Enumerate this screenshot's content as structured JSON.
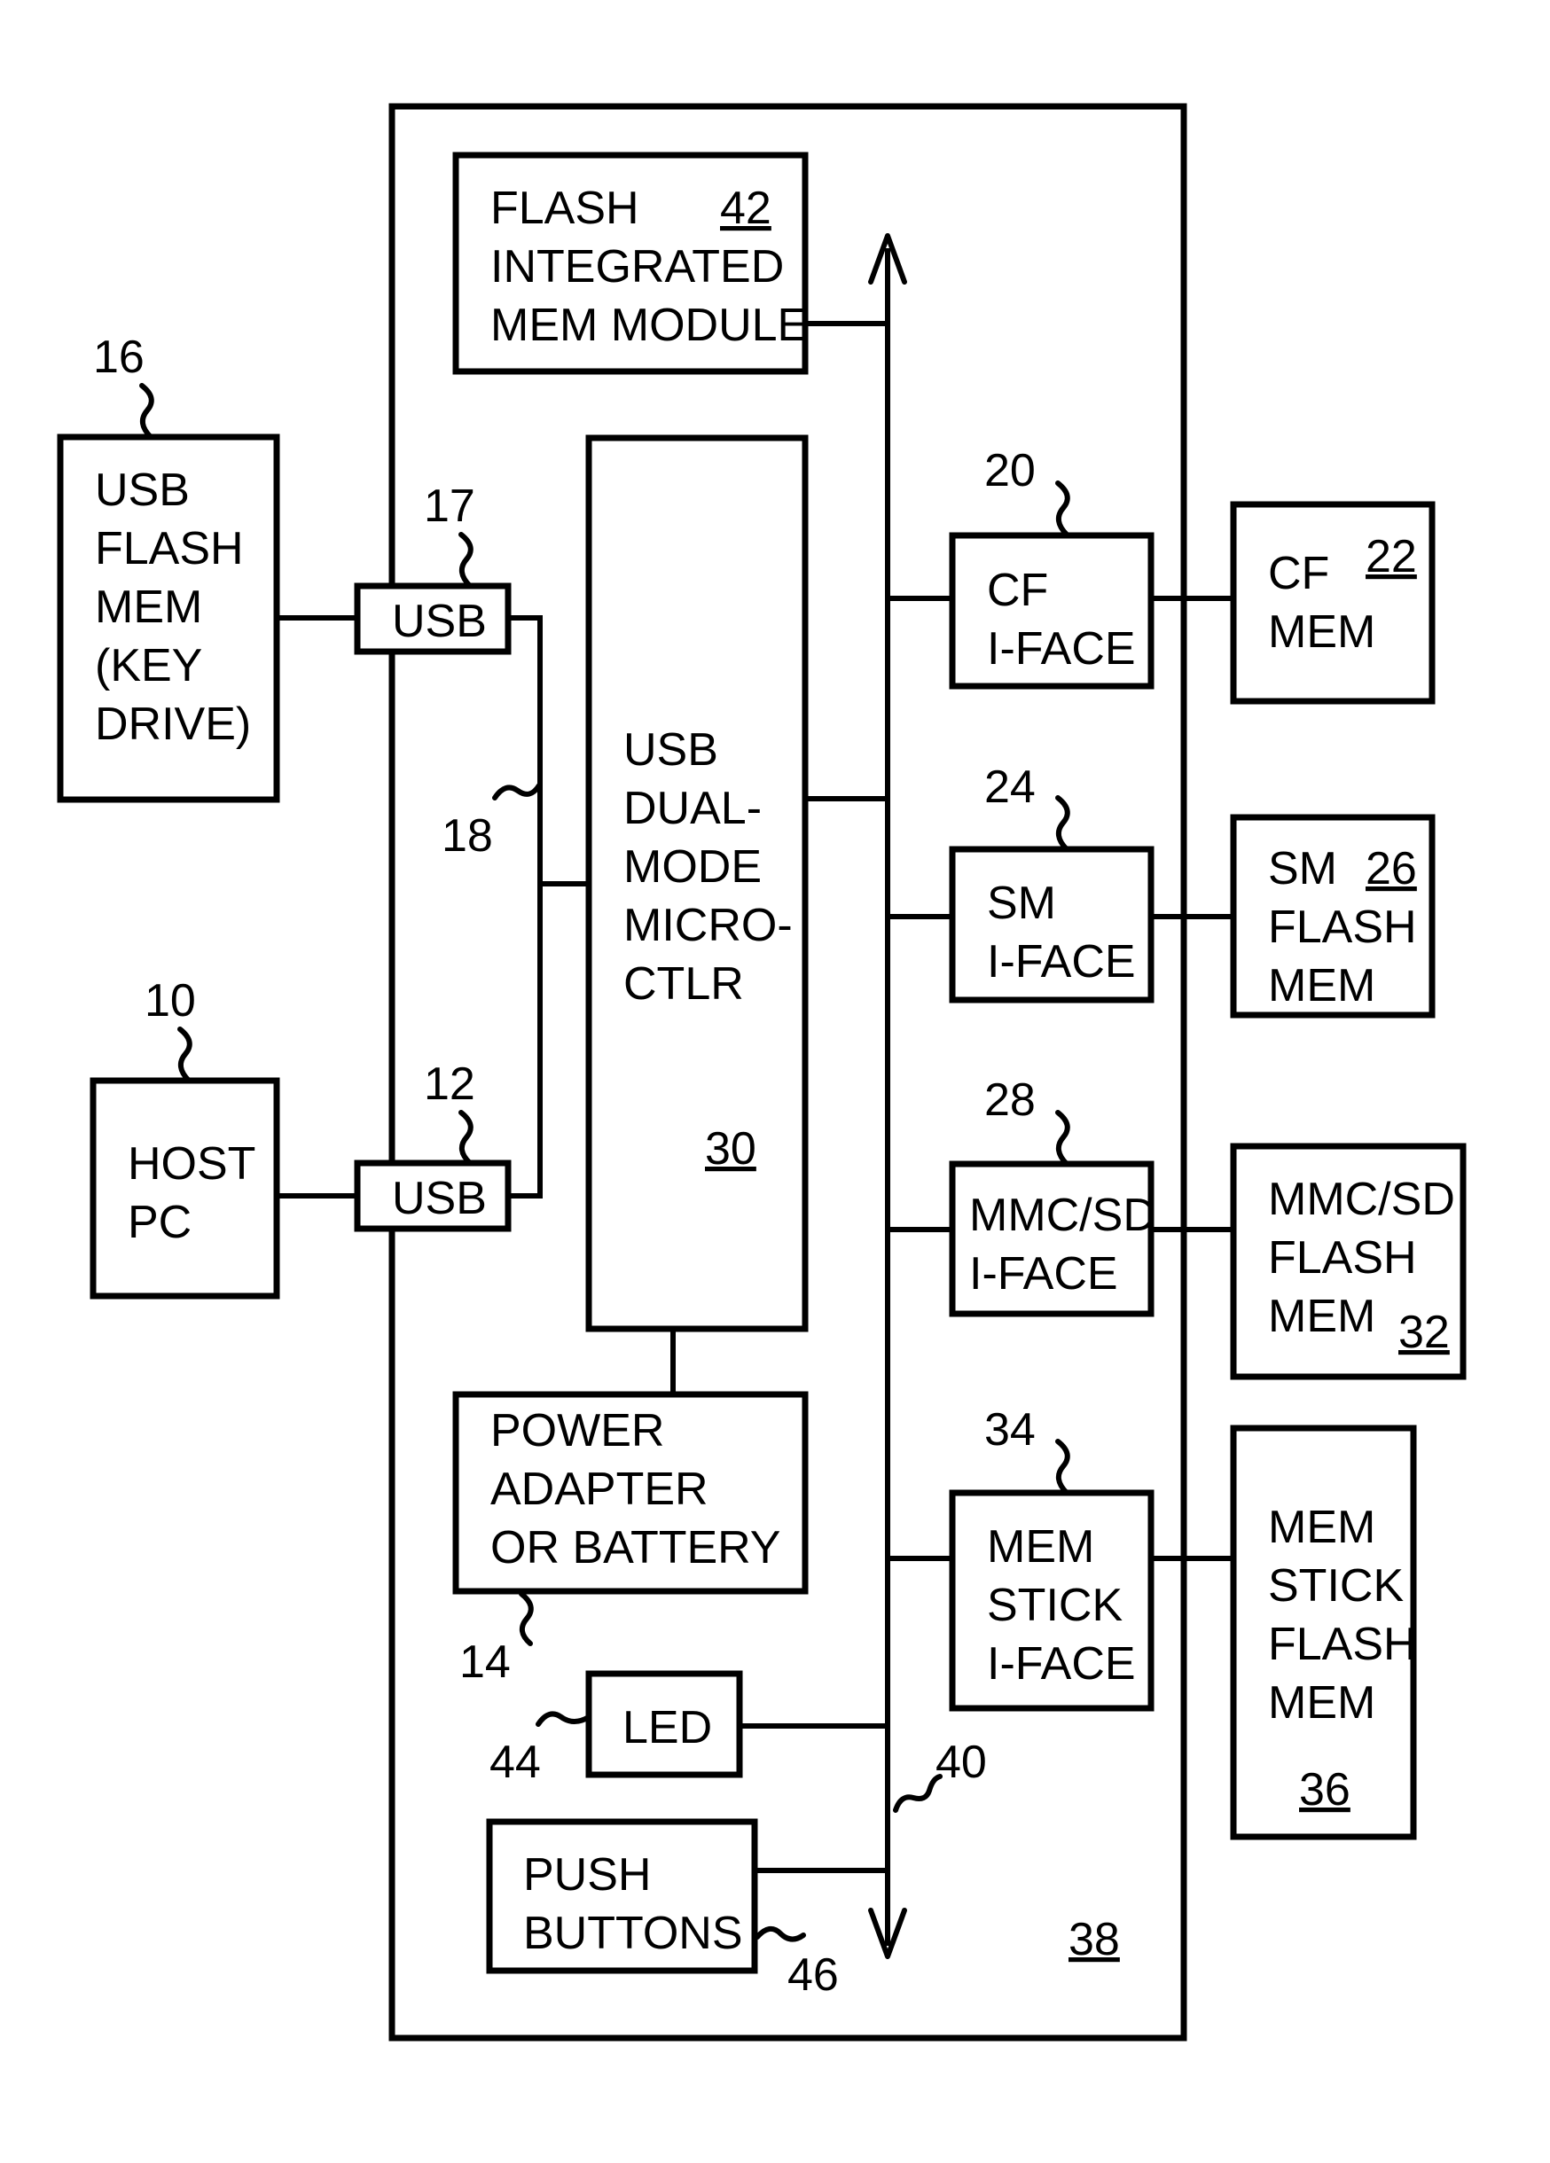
{
  "figure": {
    "enclosure": {
      "ref": "38"
    },
    "bus": {
      "ref": "40"
    },
    "usb_link": {
      "ref": "18"
    },
    "blocks": {
      "flash_module": {
        "lines": [
          "FLASH",
          "INTEGRATED",
          "MEM MODULE"
        ],
        "ref": "42"
      },
      "microcontroller": {
        "lines": [
          "USB",
          "DUAL-",
          "MODE",
          "MICRO-",
          "CTLR"
        ],
        "ref": "30"
      },
      "usb_flash_mem": {
        "lines": [
          "USB",
          "FLASH",
          "MEM",
          "(KEY",
          "DRIVE)"
        ],
        "ref": "16"
      },
      "usb_port_17": {
        "label": "USB",
        "ref": "17"
      },
      "host_pc": {
        "lines": [
          "HOST",
          "PC"
        ],
        "ref": "10"
      },
      "usb_port_12": {
        "label": "USB",
        "ref": "12"
      },
      "cf_iface": {
        "lines": [
          "CF",
          "I-FACE"
        ],
        "ref": "20"
      },
      "cf_mem": {
        "lines": [
          "CF",
          "MEM"
        ],
        "ref": "22"
      },
      "sm_iface": {
        "lines": [
          "SM",
          "I-FACE"
        ],
        "ref": "24"
      },
      "sm_mem": {
        "lines": [
          "SM",
          "FLASH",
          "MEM"
        ],
        "ref": "26"
      },
      "mmc_iface": {
        "lines": [
          "MMC/SD",
          "I-FACE"
        ],
        "ref": "28"
      },
      "mmc_mem": {
        "lines": [
          "MMC/SD",
          "FLASH",
          "MEM"
        ],
        "ref": "32"
      },
      "ms_iface": {
        "lines": [
          "MEM",
          "STICK",
          "I-FACE"
        ],
        "ref": "34"
      },
      "ms_mem": {
        "lines": [
          "MEM",
          "STICK",
          "FLASH",
          "MEM"
        ],
        "ref": "36"
      },
      "power": {
        "lines": [
          "POWER",
          "ADAPTER",
          "OR BATTERY"
        ],
        "ref": "14"
      },
      "led": {
        "label": "LED",
        "ref": "44"
      },
      "push_buttons": {
        "lines": [
          "PUSH",
          "BUTTONS"
        ],
        "ref": "46"
      }
    }
  }
}
